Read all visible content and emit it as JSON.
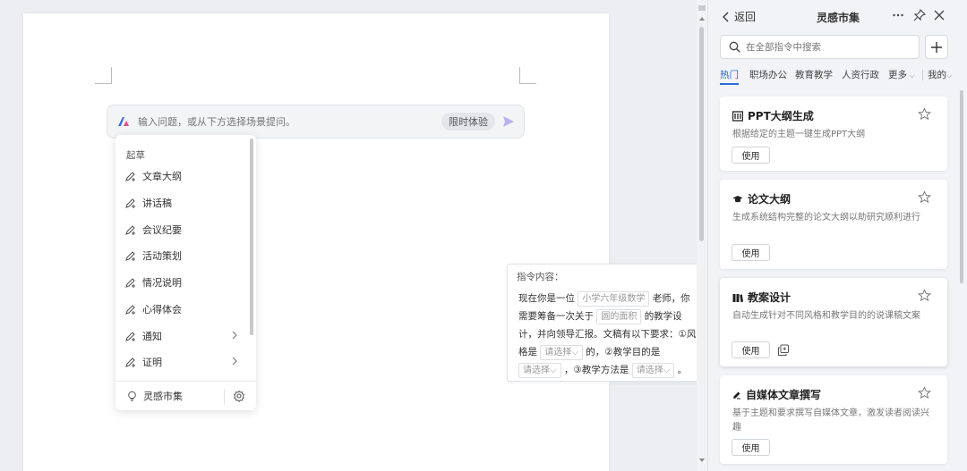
{
  "ai_bar": {
    "placeholder": "输入问题，或从下方选择场景提问。",
    "trial_badge": "限时体验"
  },
  "dropdown": {
    "section": "起草",
    "items": [
      {
        "label": "文章大纲",
        "has_submenu": false
      },
      {
        "label": "讲话稿",
        "has_submenu": false
      },
      {
        "label": "会议纪要",
        "has_submenu": false
      },
      {
        "label": "活动策划",
        "has_submenu": false
      },
      {
        "label": "情况说明",
        "has_submenu": false
      },
      {
        "label": "心得体会",
        "has_submenu": false
      },
      {
        "label": "通知",
        "has_submenu": true
      },
      {
        "label": "证明",
        "has_submenu": true
      }
    ],
    "footer_link": "灵感市集"
  },
  "instruction": {
    "title": "指令内容：",
    "t1": "现在你是一位",
    "chip1": "小学六年级数学",
    "t2": "老师，你需要筹备一次关于",
    "chip2": "圆的面积",
    "t3": "的教学设计，并向领导汇报。文稿有以下要求：①风格是",
    "sel1": "请选择",
    "t4": "的，②教学目的是",
    "sel2": "请选择",
    "t5": "，③教学方法是",
    "sel3": "请选择",
    "t6": "。"
  },
  "panel": {
    "back_label": "返回",
    "title": "灵感市集",
    "search_placeholder": "在全部指令中搜索",
    "tabs": [
      "热门",
      "职场办公",
      "教育教学",
      "人资行政",
      "更多",
      "我的"
    ],
    "use_label": "使用",
    "cards": [
      {
        "title": "PPT大纲生成",
        "desc": "根据给定的主题一键生成PPT大纲",
        "icon": "ppt-outline-icon"
      },
      {
        "title": "论文大纲",
        "desc": "生成系统结构完整的论文大纲以助研究顺利进行",
        "icon": "graduation-cap-icon"
      },
      {
        "title": "教案设计",
        "desc": "自动生成针对不同风格和教学目的的说课稿文案",
        "icon": "books-icon"
      },
      {
        "title": "自媒体文章撰写",
        "desc": "基于主题和要求撰写自媒体文章，激发读者阅读兴趣",
        "icon": "pen-edit-icon"
      }
    ]
  },
  "colors": {
    "accent": "#2a6ad8",
    "panel_bg": "#f2f3f6",
    "page_bg": "#eceef2"
  }
}
